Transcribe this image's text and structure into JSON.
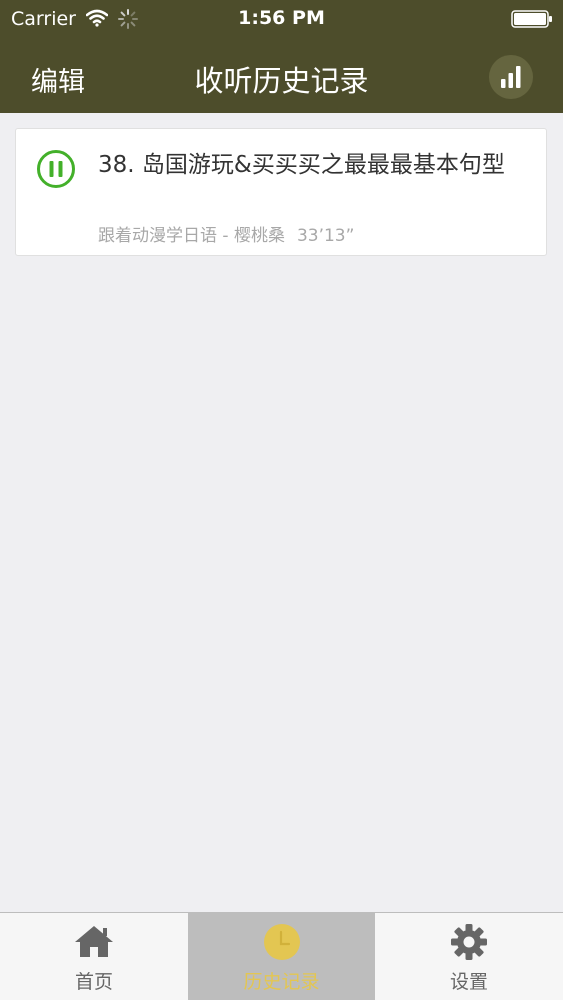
{
  "status_bar": {
    "carrier": "Carrier",
    "time": "1:56 PM"
  },
  "nav": {
    "edit_label": "编辑",
    "title": "收听历史记录"
  },
  "history": {
    "items": [
      {
        "title": "38. 岛国游玩&买买买之最最最基本句型",
        "subtitle": "跟着动漫学日语 - 樱桃桑",
        "duration": "33’13”",
        "state_icon": "pause-icon"
      }
    ]
  },
  "tabs": [
    {
      "label": "首页",
      "icon": "home-icon",
      "active": false
    },
    {
      "label": "历史记录",
      "icon": "clock-icon",
      "active": true
    },
    {
      "label": "设置",
      "icon": "gear-icon",
      "active": false
    }
  ],
  "colors": {
    "header_bg": "#4d4d2b",
    "accent_green": "#43b02a",
    "active_tab_bg": "#bdbdbd",
    "active_tab_label": "#e3c652"
  }
}
